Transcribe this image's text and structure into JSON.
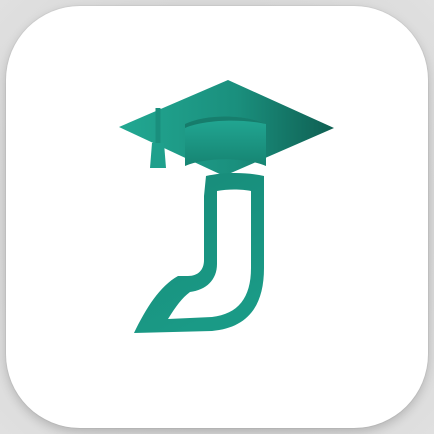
{
  "app_icon": {
    "description_name": "graduation-j-logo",
    "colors": {
      "background": "#ffffff",
      "teal_light": "#1fa08c",
      "teal_mid": "#188a78",
      "teal_dark": "#106454",
      "cap_dark": "#0f5c4f",
      "letter_inner": "#ffffff"
    }
  }
}
